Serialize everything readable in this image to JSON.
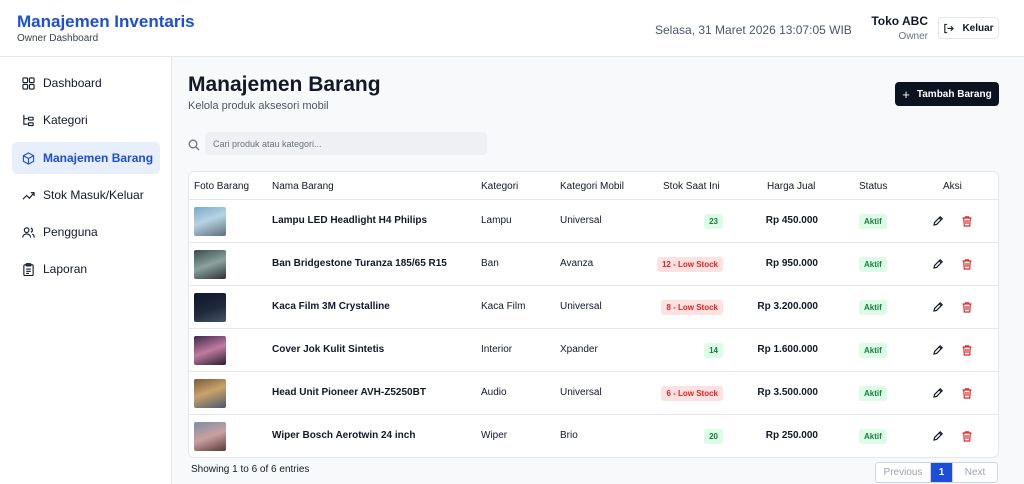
{
  "header": {
    "title": "Manajemen Inventaris",
    "subtitle": "Owner Dashboard",
    "datetime": "Selasa, 31 Maret 2026 13:07:05 WIB",
    "user_name": "Toko ABC",
    "user_role": "Owner",
    "logout_label": "Keluar"
  },
  "sidebar": {
    "items": [
      {
        "label": "Dashboard",
        "icon": "grid-icon"
      },
      {
        "label": "Kategori",
        "icon": "tree-icon"
      },
      {
        "label": "Manajemen Barang",
        "icon": "box-icon",
        "active": true
      },
      {
        "label": "Stok Masuk/Keluar",
        "icon": "trend-icon"
      },
      {
        "label": "Pengguna",
        "icon": "users-icon"
      },
      {
        "label": "Laporan",
        "icon": "clipboard-icon"
      }
    ]
  },
  "main": {
    "title": "Manajemen Barang",
    "subtitle": "Kelola produk aksesori mobil",
    "add_label": "Tambah Barang",
    "search_placeholder": "Cari produk atau kategori..."
  },
  "table": {
    "headers": [
      "Foto Barang",
      "Nama Barang",
      "Kategori",
      "Kategori Mobil",
      "Stok Saat Ini",
      "Harga Jual",
      "Status",
      "Aksi"
    ],
    "rows": [
      {
        "name": "Lampu LED Headlight H4 Philips",
        "category": "Lampu",
        "car": "Universal",
        "stock": "23",
        "stock_low": false,
        "price": "Rp 450.000",
        "status": "Aktif"
      },
      {
        "name": "Ban Bridgestone Turanza 185/65 R15",
        "category": "Ban",
        "car": "Avanza",
        "stock": "12 - Low Stock",
        "stock_low": true,
        "price": "Rp 950.000",
        "status": "Aktif"
      },
      {
        "name": "Kaca Film 3M Crystalline",
        "category": "Kaca Film",
        "car": "Universal",
        "stock": "8 - Low Stock",
        "stock_low": true,
        "price": "Rp 3.200.000",
        "status": "Aktif"
      },
      {
        "name": "Cover Jok Kulit Sintetis",
        "category": "Interior",
        "car": "Xpander",
        "stock": "14",
        "stock_low": false,
        "price": "Rp 1.600.000",
        "status": "Aktif"
      },
      {
        "name": "Head Unit Pioneer AVH-Z5250BT",
        "category": "Audio",
        "car": "Universal",
        "stock": "6 - Low Stock",
        "stock_low": true,
        "price": "Rp 3.500.000",
        "status": "Aktif"
      },
      {
        "name": "Wiper Bosch Aerotwin 24 inch",
        "category": "Wiper",
        "car": "Brio",
        "stock": "20",
        "stock_low": false,
        "price": "Rp 250.000",
        "status": "Aktif"
      }
    ]
  },
  "footer": {
    "showing": "Showing 1 to 6 of 6 entries",
    "prev_label": "Previous",
    "current_page": "1",
    "next_label": "Next"
  },
  "colors": {
    "accent": "#1d4ed8",
    "dark_button": "#0b1220",
    "ok_bg": "#dcfce7",
    "ok_text": "#15803d",
    "low_bg": "#fee2e2",
    "low_text": "#dc2626"
  }
}
